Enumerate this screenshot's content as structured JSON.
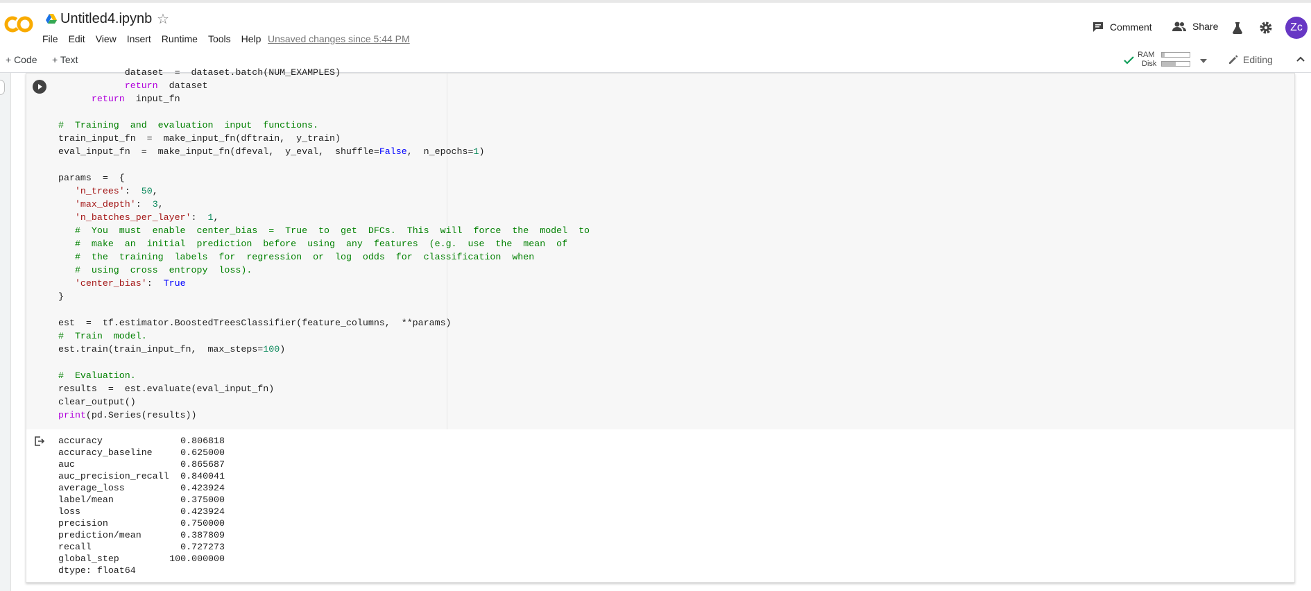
{
  "header": {
    "file_name": "Untitled4.ipynb",
    "star_glyph": "☆",
    "menu": [
      "File",
      "Edit",
      "View",
      "Insert",
      "Runtime",
      "Tools",
      "Help"
    ],
    "unsaved_text": "Unsaved changes since 5:44 PM",
    "comment_label": "Comment",
    "share_label": "Share",
    "avatar_initials": "Zc",
    "avatar_color": "#6737c4",
    "logo_color": "#f9ab00"
  },
  "toolbar": {
    "add_code_label": "+ Code",
    "add_text_label": "+ Text",
    "ram_label": "RAM",
    "disk_label": "Disk",
    "ram_usage": 0.1,
    "disk_usage": 0.5,
    "editing_label": "Editing"
  },
  "code_lines": [
    "            dataset  =  dataset.batch(NUM_EXAMPLES)",
    "            return  dataset",
    "      return  input_fn",
    "",
    "#  Training  and  evaluation  input  functions.",
    "train_input_fn  =  make_input_fn(dftrain,  y_train)",
    "eval_input_fn  =  make_input_fn(dfeval,  y_eval,  shuffle=False,  n_epochs=1)",
    "",
    "params  =  {",
    "   'n_trees':  50,",
    "   'max_depth':  3,",
    "   'n_batches_per_layer':  1,",
    "   #  You  must  enable  center_bias  =  True  to  get  DFCs.  This  will  force  the  model  to",
    "   #  make  an  initial  prediction  before  using  any  features  (e.g.  use  the  mean  of",
    "   #  the  training  labels  for  regression  or  log  odds  for  classification  when",
    "   #  using  cross  entropy  loss).",
    "   'center_bias':  True",
    "}",
    "",
    "est  =  tf.estimator.BoostedTreesClassifier(feature_columns,  **params)",
    "#  Train  model.",
    "est.train(train_input_fn,  max_steps=100)",
    "",
    "#  Evaluation.",
    "results  =  est.evaluate(eval_input_fn)",
    "clear_output()",
    "print(pd.Series(results))"
  ],
  "output": {
    "rows": [
      {
        "key": "accuracy",
        "value": "0.806818"
      },
      {
        "key": "accuracy_baseline",
        "value": "0.625000"
      },
      {
        "key": "auc",
        "value": "0.865687"
      },
      {
        "key": "auc_precision_recall",
        "value": "0.840041"
      },
      {
        "key": "average_loss",
        "value": "0.423924"
      },
      {
        "key": "label/mean",
        "value": "0.375000"
      },
      {
        "key": "loss",
        "value": "0.423924"
      },
      {
        "key": "precision",
        "value": "0.750000"
      },
      {
        "key": "prediction/mean",
        "value": "0.387809"
      },
      {
        "key": "recall",
        "value": "0.727273"
      },
      {
        "key": "global_step",
        "value": "100.000000"
      }
    ],
    "dtype_line": "dtype: float64"
  }
}
